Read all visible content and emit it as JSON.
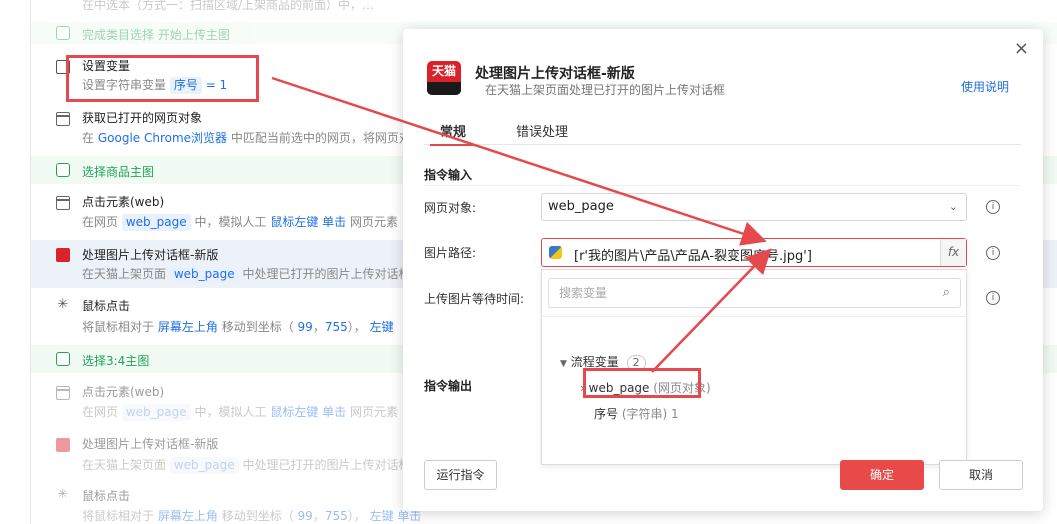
{
  "flow": {
    "top_partial": "在中选本（方式一：扫描区域/上架商品的前面）中，…",
    "section_done": "完成类目选择 开始上传主图",
    "set_var": {
      "title": "设置变量",
      "desc_prefix": "设置字符串变量",
      "var": "序号",
      "eq": "= 1"
    },
    "get_page": {
      "title": "获取已打开的网页对象",
      "desc_prefix": "在",
      "browser": "Google Chrome浏览器",
      "desc_suffix": "中匹配当前选中的网页，将网页对"
    },
    "section_main": "选择商品主图",
    "click_web": {
      "title": "点击元素(web)",
      "desc_prefix": "在网页",
      "page": "web_page",
      "desc_mid": "中，模拟人工",
      "btn": "鼠标左键",
      "action": "单击",
      "desc_suffix": "网页元素"
    },
    "tmall_upload": {
      "title": "处理图片上传对话框-新版",
      "desc_prefix": "在天猫上架页面",
      "page": "web_page",
      "desc_suffix": "中处理已打开的图片上传对话框"
    },
    "mouse_click": {
      "title": "鼠标点击",
      "desc_prefix": "将鼠标相对于",
      "anchor": "屏幕左上角",
      "desc_mid": "移动到坐标（",
      "x": "99",
      "comma": "，",
      "y": "755",
      "close": "），",
      "btn": "左键"
    },
    "section_34": "选择3:4主图",
    "click_web2": {
      "title": "点击元素(web)",
      "desc_prefix": "在网页",
      "page": "web_page",
      "desc_mid": "中，模拟人工",
      "btn": "鼠标左键",
      "action": "单击",
      "desc_suffix": "网页元素"
    },
    "tmall_upload2": {
      "title": "处理图片上传对话框-新版",
      "desc_prefix": "在天猫上架页面",
      "page": "web_page",
      "desc_suffix": "中处理已打开的图片上传对话框"
    },
    "mouse_click2": {
      "title": "鼠标点击",
      "desc_prefix": "将鼠标相对于",
      "anchor": "屏幕左上角",
      "desc_mid": "移动到坐标（",
      "x": "99",
      "comma": "，",
      "y": "755",
      "close": "），",
      "btn": "左键",
      "action": "单击"
    }
  },
  "dialog": {
    "close": "×",
    "icon_text": "天猫",
    "title": "处理图片上传对话框-新版",
    "subtitle": "在天猫上架页面处理已打开的图片上传对话框",
    "help": "使用说明",
    "tabs": [
      "常规",
      "错误处理"
    ],
    "input_section": "指令输入",
    "output_section": "指令输出",
    "fields": {
      "web_object_label": "网页对象:",
      "web_object_value": "web_page",
      "image_path_label": "图片路径:",
      "image_path_value": "[r'我的图片\\产品\\产品A-裂变图序号.jpg']",
      "fx": "fx",
      "wait_label": "上传图片等待时间:"
    },
    "dropdown": {
      "search_placeholder": "搜索变量",
      "group": "流程变量",
      "group_count": "2",
      "items": [
        {
          "name": "web_page",
          "type": "(网页对象)"
        },
        {
          "name": "序号",
          "type": "(字符串)",
          "value": "1"
        }
      ]
    },
    "buttons": {
      "run": "运行指令",
      "ok": "确定",
      "cancel": "取消"
    }
  },
  "colors": {
    "accent": "#1f6fe5",
    "danger": "#e5484d",
    "section": "#22a35a",
    "tmall": "#d9222a"
  }
}
